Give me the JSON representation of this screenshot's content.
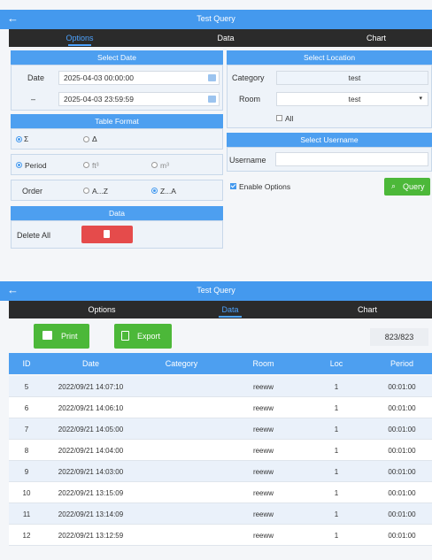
{
  "top": {
    "title": "Test Query",
    "tabs": [
      "Options",
      "Data",
      "Chart"
    ],
    "select_date": {
      "header": "Select Date",
      "date_label": "Date",
      "dash_label": "–",
      "start": "2025-04-03 00:00:00",
      "end": "2025-04-03 23:59:59"
    },
    "select_location": {
      "header": "Select Location",
      "category_label": "Category",
      "category_value": "test",
      "room_label": "Room",
      "room_value": "test",
      "all_label": "All"
    },
    "table_format": {
      "header": "Table Format",
      "sum_label": "Σ",
      "delta_label": "Δ",
      "period_label": "Period",
      "ft3_label": "ft³",
      "m3_label": "m³",
      "order_label": "Order",
      "az_label": "A...Z",
      "za_label": "Z...A"
    },
    "select_username": {
      "header": "Select Username",
      "username_label": "Username",
      "username_value": ""
    },
    "enable_options_label": "Enable Options",
    "query_label": "Query",
    "data_section": {
      "header": "Data",
      "delete_all_label": "Delete All"
    }
  },
  "bottom": {
    "title": "Test Query",
    "tabs": [
      "Options",
      "Data",
      "Chart"
    ],
    "print_label": "Print",
    "export_label": "Export",
    "count": "823/823",
    "columns": [
      "ID",
      "Date",
      "Category",
      "Room",
      "Loc",
      "Period"
    ],
    "rows": [
      {
        "id": "5",
        "date": "2022/09/21 14:07:10",
        "category": "",
        "room": "reeww",
        "loc": "1",
        "period": "00:01:00"
      },
      {
        "id": "6",
        "date": "2022/09/21 14:06:10",
        "category": "",
        "room": "reeww",
        "loc": "1",
        "period": "00:01:00"
      },
      {
        "id": "7",
        "date": "2022/09/21 14:05:00",
        "category": "",
        "room": "reeww",
        "loc": "1",
        "period": "00:01:00"
      },
      {
        "id": "8",
        "date": "2022/09/21 14:04:00",
        "category": "",
        "room": "reeww",
        "loc": "1",
        "period": "00:01:00"
      },
      {
        "id": "9",
        "date": "2022/09/21 14:03:00",
        "category": "",
        "room": "reeww",
        "loc": "1",
        "period": "00:01:00"
      },
      {
        "id": "10",
        "date": "2022/09/21 13:15:09",
        "category": "",
        "room": "reeww",
        "loc": "1",
        "period": "00:01:00"
      },
      {
        "id": "11",
        "date": "2022/09/21 13:14:09",
        "category": "",
        "room": "reeww",
        "loc": "1",
        "period": "00:01:00"
      },
      {
        "id": "12",
        "date": "2022/09/21 13:12:59",
        "category": "",
        "room": "reeww",
        "loc": "1",
        "period": "00:01:00"
      }
    ]
  },
  "colors": {
    "primary": "#4499ee",
    "tab_bar": "#2b2b2b",
    "active_tab": "#4da3ff",
    "green": "#4cb839",
    "delete_red": "#e54b4b"
  }
}
